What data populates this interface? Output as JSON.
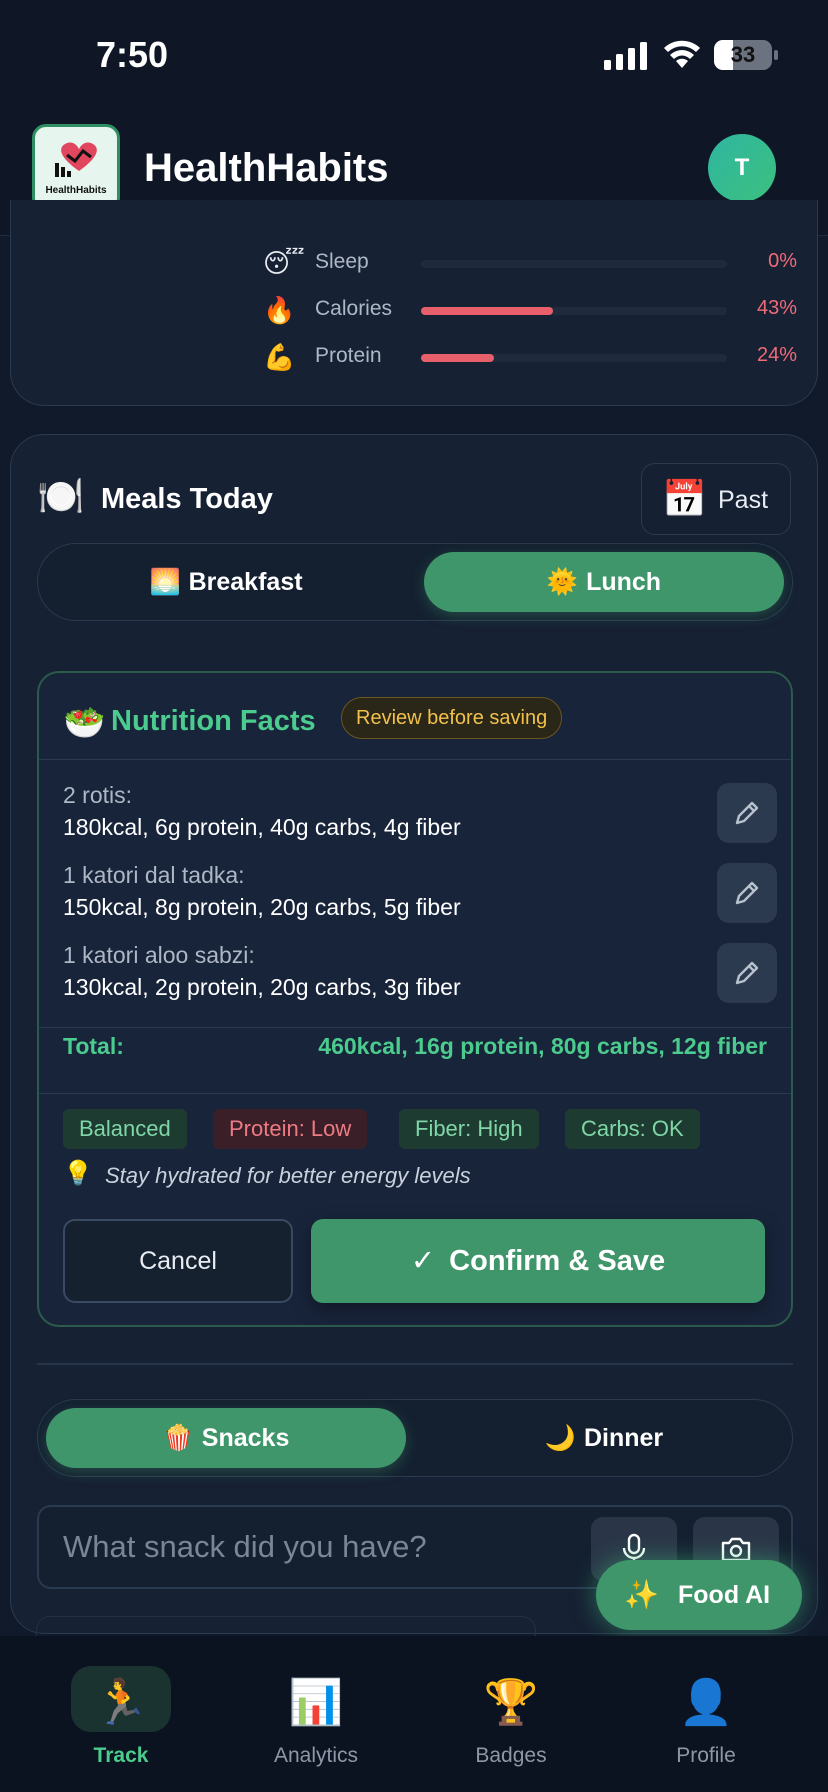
{
  "status_bar": {
    "time": "7:50",
    "battery": "33"
  },
  "header": {
    "app_name": "HealthHabits",
    "logo_text": "HealthHabits",
    "avatar_initial": "T"
  },
  "progress": {
    "metrics": [
      {
        "emoji": "😴",
        "label": "Sleep",
        "percent": "0%",
        "value": 0
      },
      {
        "emoji": "🔥",
        "label": "Calories",
        "percent": "43%",
        "value": 0.43
      },
      {
        "emoji": "💪",
        "label": "Protein",
        "percent": "24%",
        "value": 0.24
      }
    ],
    "fill_color": "#e85f6c"
  },
  "meals": {
    "icon": "🍽️",
    "title": "Meals Today",
    "past_icon": "📅",
    "past_label": "Past",
    "tabs_top": [
      {
        "emoji": "🌅",
        "label": "Breakfast",
        "active": false
      },
      {
        "emoji": "🌞",
        "label": "Lunch",
        "active": true
      }
    ],
    "tabs_bottom": [
      {
        "emoji": "🍿",
        "label": "Snacks",
        "active": true
      },
      {
        "emoji": "🌙",
        "label": "Dinner",
        "active": false
      }
    ]
  },
  "nutrition": {
    "icon": "🥗",
    "title": "Nutrition Facts",
    "badge": "Review before saving",
    "items": [
      {
        "name": "2 rotis:",
        "detail": "180kcal, 6g protein, 40g carbs, 4g fiber"
      },
      {
        "name": "1 katori dal tadka:",
        "detail": "150kcal, 8g protein, 20g carbs, 5g fiber"
      },
      {
        "name": "1 katori aloo sabzi:",
        "detail": "130kcal, 2g protein, 20g carbs, 3g fiber"
      }
    ],
    "total_label": "Total:",
    "total_value": "460kcal, 16g protein, 80g carbs, 12g fiber",
    "tags": [
      {
        "label": "Balanced",
        "tone": "green"
      },
      {
        "label": "Protein: Low",
        "tone": "red"
      },
      {
        "label": "Fiber: High",
        "tone": "green"
      },
      {
        "label": "Carbs: OK",
        "tone": "green"
      }
    ],
    "tip_icon": "💡",
    "tip": "Stay hydrated for better energy levels",
    "cancel_label": "Cancel",
    "confirm_label": "Confirm & Save"
  },
  "snack_input": {
    "placeholder": "What snack did you have?"
  },
  "food_ai": {
    "icon": "✨",
    "label": "Food AI"
  },
  "tab_bar": [
    {
      "icon": "🏃",
      "label": "Track",
      "active": true
    },
    {
      "icon": "📊",
      "label": "Analytics",
      "active": false
    },
    {
      "icon": "🏆",
      "label": "Badges",
      "active": false
    },
    {
      "icon": "👤",
      "label": "Profile",
      "active": false
    }
  ],
  "colors": {
    "accent": "#3e966a",
    "accent_text": "#4ccb8e",
    "background": "#111a2b"
  }
}
